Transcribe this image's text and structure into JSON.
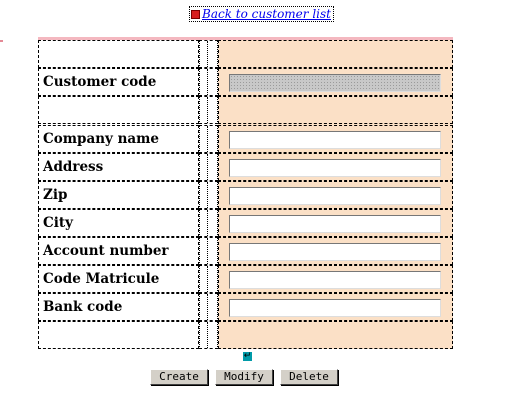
{
  "back_link": {
    "label": "Back to customer list"
  },
  "form": {
    "rows": [
      {
        "label": "",
        "field": false
      },
      {
        "label": "Customer code",
        "field": true,
        "readonly": true,
        "value": ""
      },
      {
        "label": "",
        "field": false
      },
      {
        "label": "Company name",
        "field": true,
        "value": ""
      },
      {
        "label": "Address",
        "field": true,
        "value": ""
      },
      {
        "label": "Zip",
        "field": true,
        "value": ""
      },
      {
        "label": "City",
        "field": true,
        "value": ""
      },
      {
        "label": "Account number",
        "field": true,
        "value": ""
      },
      {
        "label": "Code Matricule",
        "field": true,
        "value": ""
      },
      {
        "label": "Bank code",
        "field": true,
        "value": ""
      },
      {
        "label": "",
        "field": false
      }
    ]
  },
  "icons": {
    "back": "red-square-icon",
    "enter": "enter-key-icon"
  },
  "colors": {
    "input_column_bg": "#fbe0c6",
    "top_accent": "#f4b8c0",
    "button_face": "#d4d0c8",
    "link": "#0000ee"
  },
  "buttons": {
    "create": "Create",
    "modify": "Modify",
    "delete": "Delete"
  }
}
